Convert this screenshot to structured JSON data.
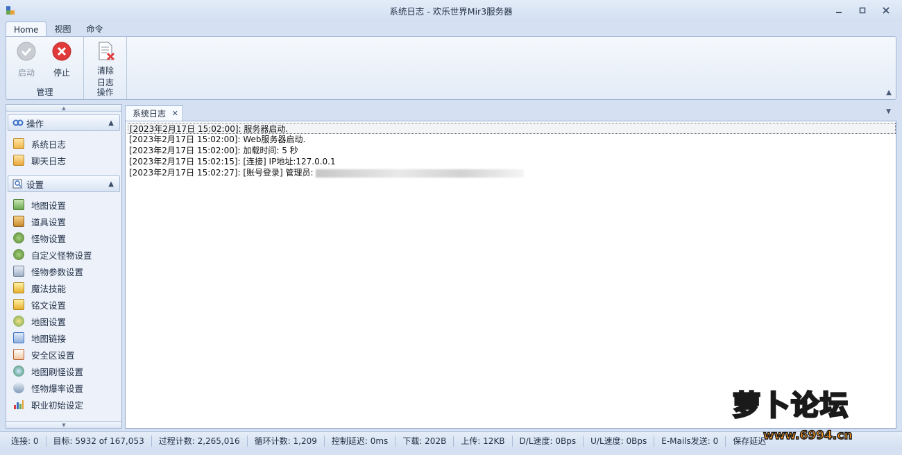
{
  "window": {
    "title": "系统日志 - 欢乐世界Mir3服务器",
    "min_icon": "minimize-icon",
    "max_icon": "restore-icon",
    "close_icon": "close-icon"
  },
  "ribbon": {
    "tabs": [
      {
        "label": "Home"
      },
      {
        "label": "视图"
      },
      {
        "label": "命令"
      }
    ],
    "groups": [
      {
        "caption": "管理",
        "buttons": [
          {
            "label": "启动",
            "icon": "check-icon"
          },
          {
            "label": "停止",
            "icon": "stop-icon"
          }
        ]
      },
      {
        "caption": "操作",
        "buttons": [
          {
            "label_line1": "清除",
            "label_line2": "日志",
            "icon": "clear-log-icon"
          }
        ]
      }
    ]
  },
  "sidebar": {
    "groups": [
      {
        "title": "操作",
        "items": [
          {
            "label": "系统日志",
            "icon": "system-log-icon"
          },
          {
            "label": "聊天日志",
            "icon": "chat-log-icon"
          }
        ]
      },
      {
        "title": "设置",
        "items": [
          {
            "label": "地图设置",
            "icon": "map-settings-icon"
          },
          {
            "label": "道具设置",
            "icon": "item-settings-icon"
          },
          {
            "label": "怪物设置",
            "icon": "monster-settings-icon"
          },
          {
            "label": "自定义怪物设置",
            "icon": "custom-monster-icon"
          },
          {
            "label": "怪物参数设置",
            "icon": "monster-params-icon"
          },
          {
            "label": "魔法技能",
            "icon": "magic-skill-icon"
          },
          {
            "label": "铭文设置",
            "icon": "inscription-icon"
          },
          {
            "label": "地图设置",
            "icon": "map-settings-2-icon"
          },
          {
            "label": "地图链接",
            "icon": "map-link-icon"
          },
          {
            "label": "安全区设置",
            "icon": "safe-zone-icon"
          },
          {
            "label": "地图刷怪设置",
            "icon": "map-spawn-icon"
          },
          {
            "label": "怪物爆率设置",
            "icon": "drop-rate-icon"
          },
          {
            "label": "职业初始设定",
            "icon": "class-init-icon"
          }
        ]
      }
    ]
  },
  "document": {
    "tab_label": "系统日志",
    "log_lines": [
      "[2023年2月17日 15:02:00]: 服务器启动.",
      "[2023年2月17日 15:02:00]: Web服务器启动.",
      "[2023年2月17日 15:02:00]: 加载时间: 5 秒",
      "[2023年2月17日 15:02:15]: [连接] IP地址:127.0.0.1",
      "[2023年2月17日 15:02:27]: [账号登录] 管理员:"
    ]
  },
  "statusbar": [
    "连接: 0",
    "目标: 5932 of 167,053",
    "过程计数: 2,265,016",
    "循环计数: 1,209",
    "控制延迟: 0ms",
    "下载: 202B",
    "上传: 12KB",
    "D/L速度: 0Bps",
    "U/L速度: 0Bps",
    "E-Mails发送: 0",
    "保存延迟"
  ],
  "watermark": {
    "title": "萝卜论坛",
    "url": "www.6994.cn"
  },
  "colors": {
    "accent": "#9fb6d6",
    "background": "#d5e1f2",
    "stop_red": "#e03a3a",
    "watermark_orange": "#ff9a1f"
  }
}
